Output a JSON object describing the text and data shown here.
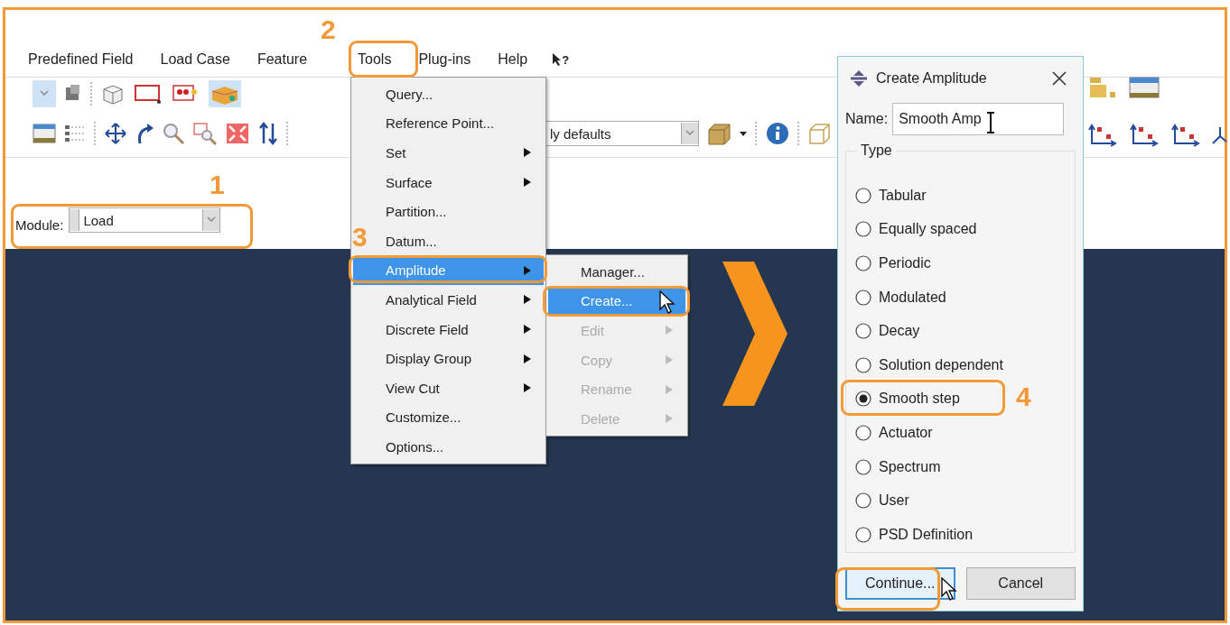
{
  "menu_bar": [
    {
      "label": "Predefined Field"
    },
    {
      "label": "Load Case"
    },
    {
      "label": "Feature"
    },
    {
      "label": "Tools"
    },
    {
      "label": "Plug-ins"
    },
    {
      "label": "Help"
    }
  ],
  "whats_this": "?",
  "toolbar_combo": "ly defaults",
  "module": {
    "label": "Module:",
    "value": "Load"
  },
  "tools_menu": [
    {
      "label": "Query...",
      "selected": false,
      "has_submenu": false
    },
    {
      "label": "Reference Point...",
      "selected": false,
      "has_submenu": false
    },
    {
      "label": "Set",
      "selected": false,
      "has_submenu": true
    },
    {
      "label": "Surface",
      "selected": false,
      "has_submenu": true
    },
    {
      "label": "Partition...",
      "selected": false,
      "has_submenu": false
    },
    {
      "label": "Datum...",
      "selected": false,
      "has_submenu": false
    },
    {
      "label": "Amplitude",
      "selected": true,
      "has_submenu": true
    },
    {
      "label": "Analytical Field",
      "selected": false,
      "has_submenu": true
    },
    {
      "label": "Discrete Field",
      "selected": false,
      "has_submenu": true
    },
    {
      "label": "Display Group",
      "selected": false,
      "has_submenu": true
    },
    {
      "label": "View Cut",
      "selected": false,
      "has_submenu": true
    },
    {
      "label": "Customize...",
      "selected": false,
      "has_submenu": false
    },
    {
      "label": "Options...",
      "selected": false,
      "has_submenu": false
    }
  ],
  "amplitude_submenu": [
    {
      "label": "Manager...",
      "selected": false,
      "disabled": false,
      "has_submenu": false
    },
    {
      "label": "Create...",
      "selected": true,
      "disabled": false,
      "has_submenu": false
    },
    {
      "label": "Edit",
      "selected": false,
      "disabled": true,
      "has_submenu": true
    },
    {
      "label": "Copy",
      "selected": false,
      "disabled": true,
      "has_submenu": true
    },
    {
      "label": "Rename",
      "selected": false,
      "disabled": true,
      "has_submenu": true
    },
    {
      "label": "Delete",
      "selected": false,
      "disabled": true,
      "has_submenu": true
    }
  ],
  "dialog": {
    "title": "Create Amplitude",
    "name_label": "Name:",
    "name_value": "Smooth Amp",
    "type_label": "Type",
    "options": [
      {
        "label": "Tabular",
        "selected": false
      },
      {
        "label": "Equally spaced",
        "selected": false
      },
      {
        "label": "Periodic",
        "selected": false
      },
      {
        "label": "Modulated",
        "selected": false
      },
      {
        "label": "Decay",
        "selected": false
      },
      {
        "label": "Solution dependent",
        "selected": false
      },
      {
        "label": "Smooth step",
        "selected": true
      },
      {
        "label": "Actuator",
        "selected": false
      },
      {
        "label": "Spectrum",
        "selected": false
      },
      {
        "label": "User",
        "selected": false
      },
      {
        "label": "PSD Definition",
        "selected": false
      }
    ],
    "buttons": [
      {
        "label": "Continue...",
        "default": true
      },
      {
        "label": "Cancel",
        "default": false
      }
    ]
  },
  "callouts": [
    {
      "number": "1"
    },
    {
      "number": "2"
    },
    {
      "number": "3"
    },
    {
      "number": "4"
    }
  ]
}
